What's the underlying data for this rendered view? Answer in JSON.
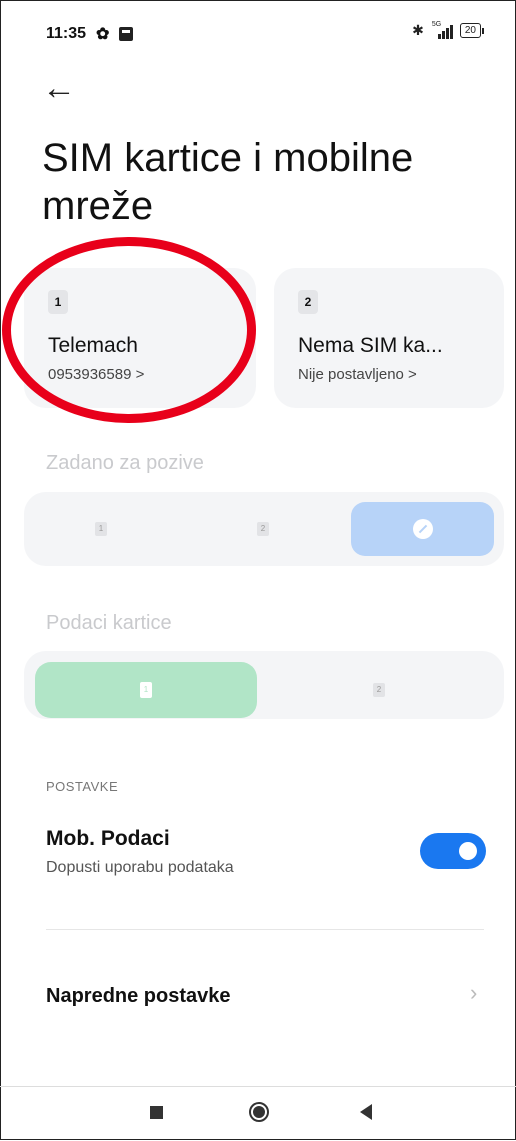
{
  "status_bar": {
    "time": "11:35",
    "network_label": "5G",
    "battery": "20"
  },
  "page": {
    "title": "SIM kartice i mobilne mreže"
  },
  "sim_cards": [
    {
      "slot": "1",
      "name": "Telemach",
      "detail": "0953936589 >"
    },
    {
      "slot": "2",
      "name": "Nema SIM ka...",
      "detail": "Nije postavljeno >"
    }
  ],
  "default_calls": {
    "label": "Zadano za pozive",
    "options": [
      "1",
      "2"
    ],
    "selected": "ask"
  },
  "data_card": {
    "label": "Podaci kartice",
    "options": [
      "1",
      "2"
    ],
    "selected": "1"
  },
  "settings": {
    "section_label": "POSTAVKE",
    "mobile_data_title": "Mob. Podaci",
    "mobile_data_subtitle": "Dopusti uporabu podataka",
    "mobile_data_enabled": true,
    "advanced_label": "Napredne postavke"
  },
  "colors": {
    "accent_blue": "#1a78f0",
    "calls_selected": "#b7d3f8",
    "data_selected": "#b1e5c7",
    "highlight_red": "#e8001a"
  }
}
